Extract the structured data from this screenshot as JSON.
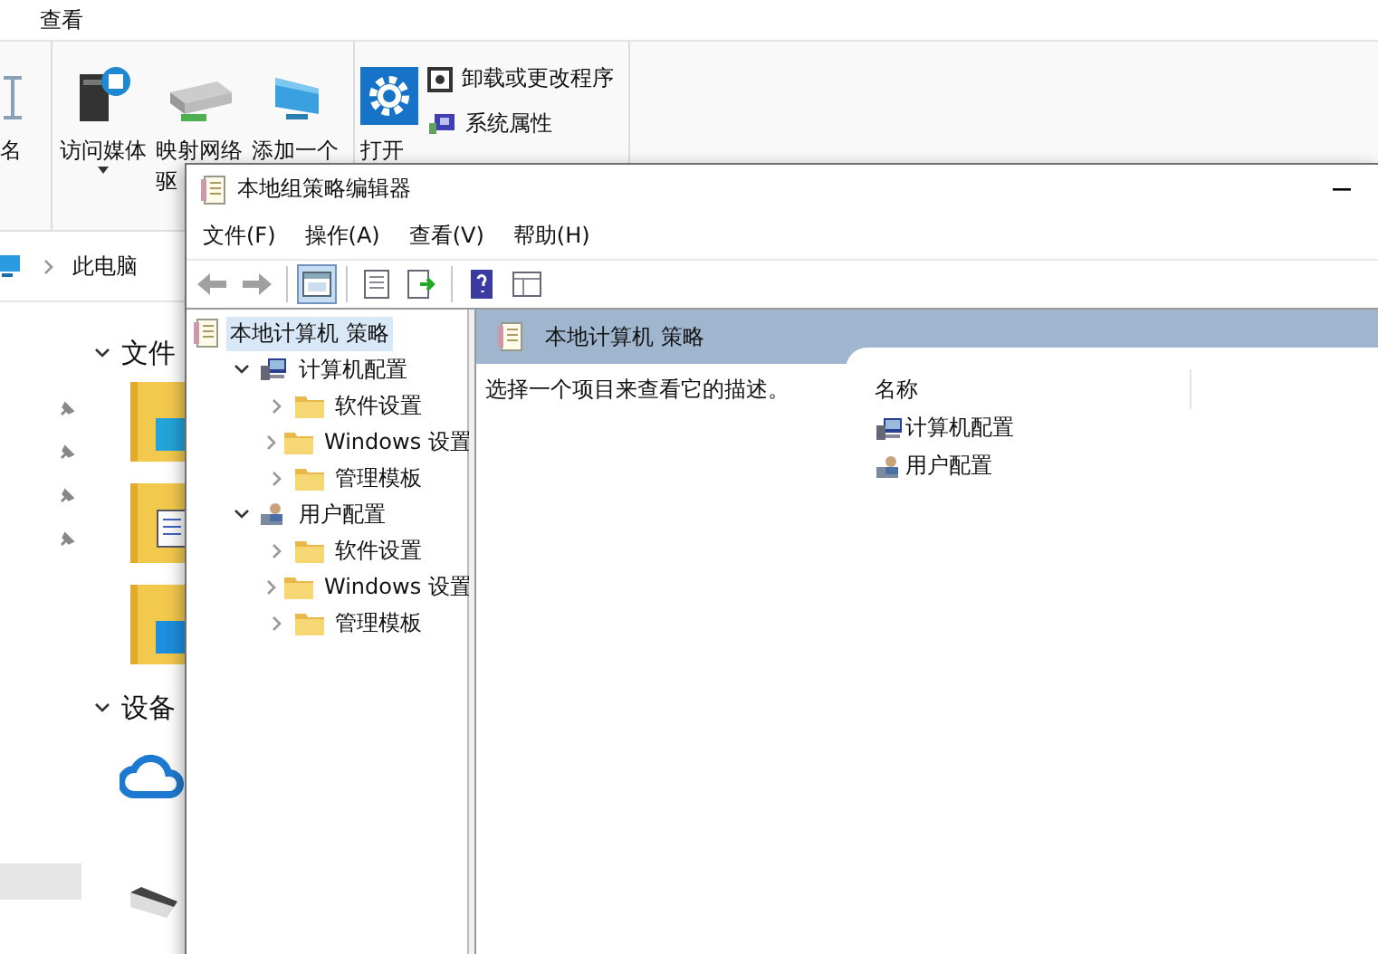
{
  "explorer": {
    "tabs": [
      {
        "label": "查看"
      }
    ],
    "ribbon": [
      {
        "items": [
          {
            "kind": "large",
            "lines": [
              "名"
            ]
          }
        ]
      },
      {
        "items": [
          {
            "kind": "large",
            "lines": [
              "访问媒体"
            ]
          },
          {
            "kind": "large",
            "lines": [
              "映射网络",
              "驱"
            ]
          },
          {
            "kind": "large",
            "lines": [
              "添加一个"
            ]
          }
        ]
      },
      {
        "items": [
          {
            "kind": "large",
            "lines": [
              "打开"
            ]
          },
          {
            "kind": "small",
            "lines": [
              "卸载或更改程序"
            ]
          },
          {
            "kind": "small",
            "lines": [
              "系统属性"
            ]
          }
        ]
      }
    ],
    "address": {
      "path": [
        "此电脑"
      ]
    },
    "sections": [
      {
        "label": "文件"
      },
      {
        "label": "设备"
      }
    ]
  },
  "editor": {
    "title": "本地组策略编辑器",
    "menus": [
      "文件(F)",
      "操作(A)",
      "查看(V)",
      "帮助(H)"
    ],
    "toolbar": [
      [
        {
          "kind": "back",
          "pressed": false
        },
        {
          "kind": "forward",
          "pressed": false
        }
      ],
      [
        {
          "kind": "tree",
          "pressed": true
        }
      ],
      [
        {
          "kind": "properties",
          "pressed": false
        },
        {
          "kind": "export",
          "pressed": false
        }
      ],
      [
        {
          "kind": "help",
          "pressed": false
        },
        {
          "kind": "view",
          "pressed": false
        }
      ]
    ],
    "tree": [
      {
        "label": "本地计算机 策略",
        "kind": "policy",
        "selected": true,
        "children": [
          {
            "label": "计算机配置",
            "kind": "computer",
            "selected": false,
            "expanded": true,
            "children": [
              {
                "label": "软件设置",
                "kind": "folder",
                "selected": false,
                "expanded": false
              },
              {
                "label": "Windows 设置",
                "kind": "folder",
                "selected": false,
                "expanded": false
              },
              {
                "label": "管理模板",
                "kind": "folder",
                "selected": false,
                "expanded": false
              }
            ]
          },
          {
            "label": "用户配置",
            "kind": "user",
            "selected": false,
            "expanded": true,
            "children": [
              {
                "label": "软件设置",
                "kind": "folder",
                "selected": false,
                "expanded": false
              },
              {
                "label": "Windows 设置",
                "kind": "folder",
                "selected": false,
                "expanded": false
              },
              {
                "label": "管理模板",
                "kind": "folder",
                "selected": false,
                "expanded": false
              }
            ]
          }
        ]
      }
    ],
    "pane": {
      "title": "本地计算机 策略",
      "description": "选择一个项目来查看它的描述。",
      "columns": [
        "名称"
      ],
      "items": [
        {
          "label": "计算机配置",
          "kind": "computer"
        },
        {
          "label": "用户配置",
          "kind": "user"
        }
      ]
    }
  }
}
